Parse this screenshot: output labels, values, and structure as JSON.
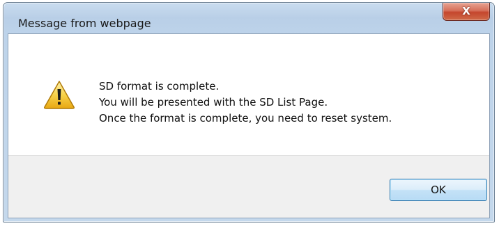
{
  "dialog": {
    "title": "Message from webpage",
    "close_icon": "close-icon",
    "close_glyph": "X",
    "icon": "warning-icon",
    "message_lines": [
      "SD format is complete.",
      "You will be presented with the SD List Page.",
      "Once the format is complete, you need to reset system."
    ],
    "ok_label": "OK"
  },
  "colors": {
    "title_bar": "#bdd3ea",
    "close_button": "#c4462d",
    "ok_border": "#3c7fb1",
    "warning_yellow": "#f5c02a"
  }
}
